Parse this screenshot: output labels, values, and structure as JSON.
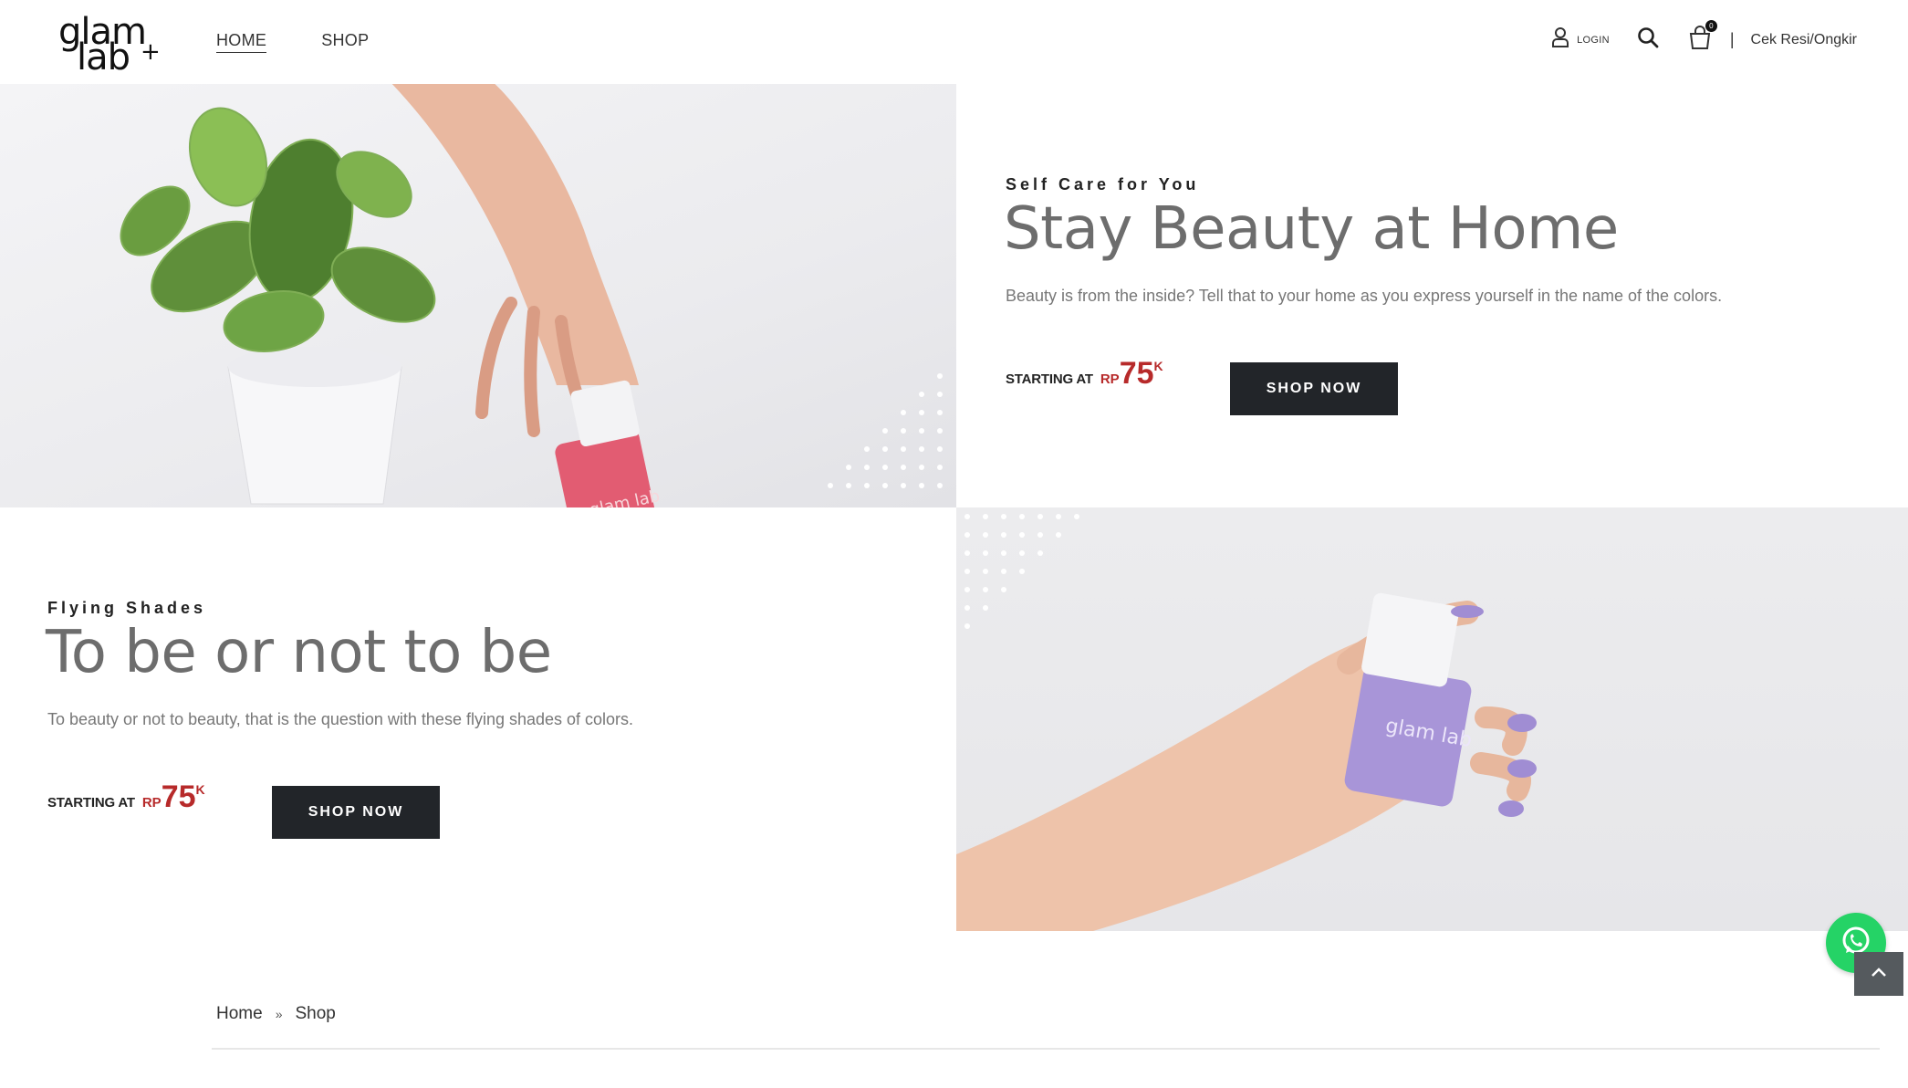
{
  "header": {
    "logo": {
      "top": "glam",
      "bottom": "lab",
      "plus": "+"
    },
    "nav": [
      {
        "label": "HOME",
        "active": true
      },
      {
        "label": "SHOP",
        "active": false
      }
    ],
    "login_label": "LOGIN",
    "cart_badge": "0",
    "separator": "|",
    "tracking_link": "Cek Resi/Ongkir"
  },
  "banners": [
    {
      "kicker": "Self Care for You",
      "headline": "Stay Beauty at Home",
      "description": "Beauty is from the inside? Tell that to your home as you express yourself in the name of the colors.",
      "price": {
        "label": "STARTING AT",
        "currency": "RP",
        "amount": "75",
        "suffix": "K"
      },
      "button": "SHOP NOW",
      "image_bottle_text": "glam lab",
      "image_bottle_color": "#e25c72"
    },
    {
      "kicker": "Flying Shades",
      "headline": "To be or not to be",
      "description": "To beauty or not to beauty, that is the question with these flying shades of colors.",
      "price": {
        "label": "STARTING AT",
        "currency": "RP",
        "amount": "75",
        "suffix": "K"
      },
      "button": "SHOP NOW",
      "image_bottle_text": "glam lab",
      "image_bottle_color": "#a895d8"
    }
  ],
  "breadcrumb": {
    "items": [
      "Home",
      "Shop"
    ],
    "separator": "»"
  },
  "colors": {
    "accent_price": "#b72a2a",
    "button_bg": "#222529",
    "whatsapp": "#25d366"
  },
  "floating": {
    "whatsapp_icon": "whatsapp-icon",
    "back_to_top_icon": "chevron-up-icon"
  }
}
